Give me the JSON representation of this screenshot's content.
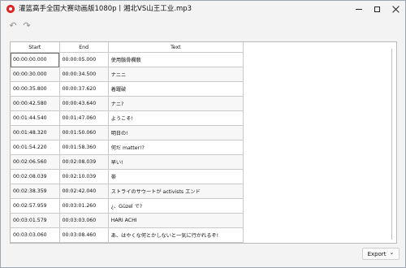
{
  "window": {
    "title": "灌篮高手全国大赛动画版1080p丨湘北VS山王工业.mp3",
    "controls": {
      "minimize": "minimize",
      "maximize": "maximize",
      "close": "close"
    }
  },
  "toolbar": {
    "undo_icon": "↶",
    "redo_icon": "↷"
  },
  "table": {
    "headers": [
      "Start",
      "End",
      "Text"
    ],
    "rows": [
      [
        "00:00:00.000",
        "00:00:05.000",
        "使用骸骨欄敎"
      ],
      [
        "00:00:30.000",
        "00:00:34.500",
        "ナニニ"
      ],
      [
        "00:00:35.800",
        "00:00:37.620",
        "着躍破"
      ],
      [
        "00:00:42.580",
        "00:00:43.640",
        "ナニ?"
      ],
      [
        "00:01:44.540",
        "00:01:47.060",
        "ようこそ!"
      ],
      [
        "00:01:48.320",
        "00:01:50.060",
        "明日の!"
      ],
      [
        "00:01:54.220",
        "00:01:58.360",
        "何だ matter!?"
      ],
      [
        "00:02:06.560",
        "00:02:08.039",
        "早い!"
      ],
      [
        "00:02:08.039",
        "00:02:10.039",
        "帯"
      ],
      [
        "00:02:38.359",
        "00:02:42.040",
        "ストライのサウートが activists エンド"
      ],
      [
        "00:02:57.959",
        "00:03:01.260",
        "¿、Güzel で?"
      ],
      [
        "00:03:01.579",
        "00:03:03.060",
        "HARI ACHI"
      ],
      [
        "00:03:03.060",
        "00:03:08.460",
        "あ、はやくな何とかしないと一気に行かれるぞ!"
      ]
    ]
  },
  "export": {
    "label": "Export",
    "chevron_icon": "⌄"
  },
  "colors": {
    "app_icon": "#e02424",
    "window_bg": "#f3f3f3",
    "grid_line": "#c9c9c9"
  }
}
